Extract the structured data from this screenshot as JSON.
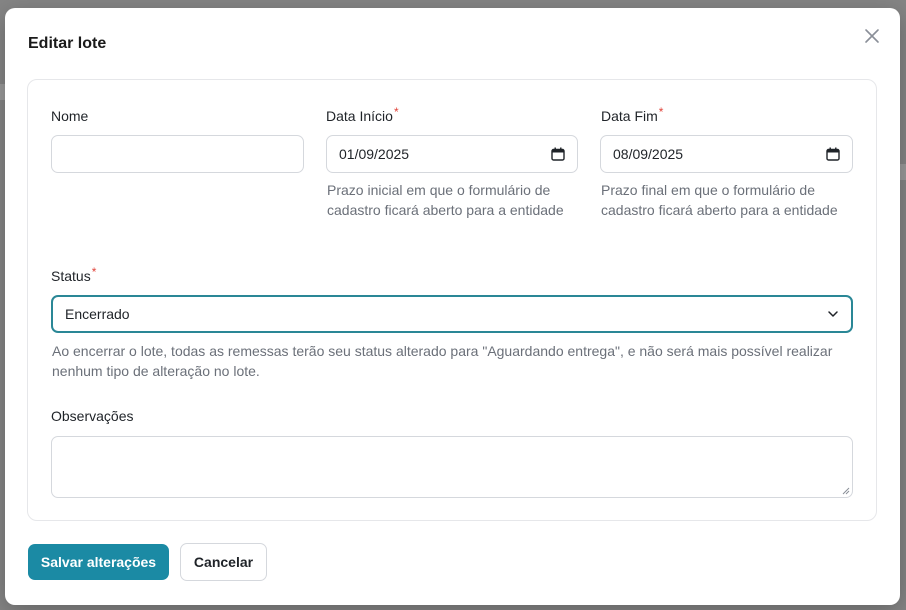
{
  "modal": {
    "title": "Editar lote",
    "close_icon": "close-icon"
  },
  "form": {
    "nome": {
      "label": "Nome",
      "value": "",
      "placeholder": ""
    },
    "data_inicio": {
      "label": "Data Início",
      "required_mark": "*",
      "value": "01/09/2025",
      "help": "Prazo inicial em que o formulário de cadastro ficará aberto para a entidade"
    },
    "data_fim": {
      "label": "Data Fim",
      "required_mark": "*",
      "value": "08/09/2025",
      "help": "Prazo final em que o formulário de cadastro ficará aberto para a entidade"
    },
    "status": {
      "label": "Status",
      "required_mark": "*",
      "value": "Encerrado",
      "help": "Ao encerrar o lote, todas as remessas terão seu status alterado para \"Aguardando entrega\", e não será mais possível realizar nenhum tipo de alteração no lote."
    },
    "observacoes": {
      "label": "Observações",
      "value": ""
    }
  },
  "actions": {
    "save_label": "Salvar alterações",
    "cancel_label": "Cancelar"
  },
  "colors": {
    "primary": "#1b8aa4",
    "focus_border": "#2a8796",
    "required": "#e0433a"
  }
}
